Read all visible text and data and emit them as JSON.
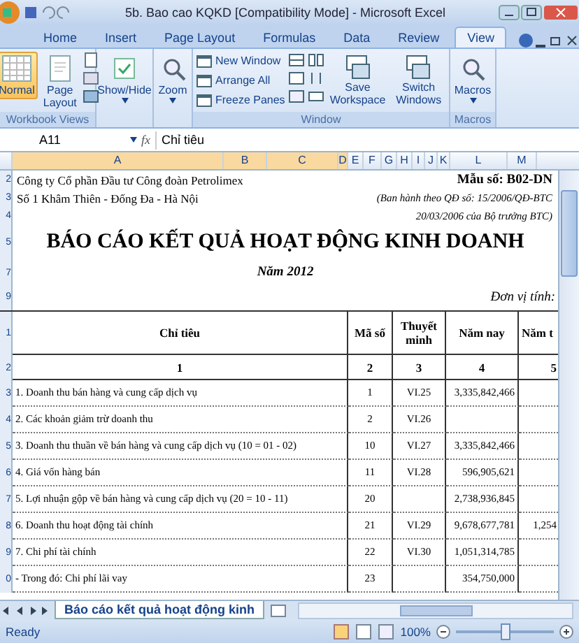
{
  "window": {
    "title": "5b. Bao cao KQKD  [Compatibility Mode] - Microsoft Excel"
  },
  "ribbon_tabs": [
    {
      "label": "Home",
      "selected": false
    },
    {
      "label": "Insert",
      "selected": false
    },
    {
      "label": "Page Layout",
      "selected": false
    },
    {
      "label": "Formulas",
      "selected": false
    },
    {
      "label": "Data",
      "selected": false
    },
    {
      "label": "Review",
      "selected": false
    },
    {
      "label": "View",
      "selected": true
    }
  ],
  "ribbon_groups": [
    {
      "kind": "views",
      "label": "Workbook Views",
      "buttons": [
        {
          "label": "Normal",
          "selected": true
        },
        {
          "label": "Page Layout",
          "selected": false
        }
      ]
    },
    {
      "kind": "single",
      "buttons": [
        {
          "label": "Show/Hide"
        }
      ]
    },
    {
      "kind": "single",
      "buttons": [
        {
          "label": "Zoom"
        }
      ]
    },
    {
      "kind": "window",
      "label": "Window",
      "small_buttons": [
        "New Window",
        "Arrange All",
        "Freeze Panes"
      ],
      "buttons": [
        {
          "label": "Save Workspace"
        },
        {
          "label": "Switch Windows"
        }
      ]
    },
    {
      "kind": "single",
      "label": "Macros",
      "buttons": [
        {
          "label": "Macros"
        }
      ]
    }
  ],
  "formula_bar": {
    "name_box": "A11",
    "function_label": "fx",
    "value": "Chỉ tiêu"
  },
  "column_headers": [
    "A",
    "B",
    "C",
    "D",
    "E",
    "F",
    "G",
    "H",
    "I",
    "J",
    "K",
    "L",
    "M"
  ],
  "sheet_lines": [
    {
      "kind": "pair",
      "row_number": "2",
      "left": "Công ty Cổ phần Đầu tư Công đoàn Petrolimex",
      "right": "Mẫu số:  B02-DN"
    },
    {
      "kind": "pair",
      "row_number": "3",
      "left": "Số 1 Khâm Thiên - Đống Đa - Hà Nội",
      "right": "(Ban hành theo QĐ số: 15/2006/QĐ-BTC"
    },
    {
      "kind": "note",
      "row_number": "4",
      "right": "20/03/2006 của Bộ trưởng BTC)"
    },
    {
      "kind": "title",
      "row_number": "5",
      "text": "BÁO CÁO KẾT QUẢ HOẠT ĐỘNG KINH DOANH"
    },
    {
      "kind": "subtitle",
      "row_number": "7",
      "text": "Năm 2012"
    },
    {
      "kind": "unit",
      "row_number": "9",
      "text": "Đơn vị tính:"
    }
  ],
  "table": {
    "header": {
      "row_number": "1",
      "cells": [
        "Chỉ tiêu",
        "Mã số",
        "Thuyết minh",
        "Năm nay",
        "Năm t"
      ]
    },
    "index_row": {
      "row_number": "2",
      "cells": [
        "1",
        "2",
        "3",
        "4",
        "5"
      ]
    },
    "rows": [
      {
        "row_number": "3",
        "cells": [
          "1. Doanh thu bán hàng và cung cấp dịch vụ",
          "1",
          "VI.25",
          "3,335,842,466",
          ""
        ]
      },
      {
        "row_number": "4",
        "cells": [
          "2. Các khoản giảm trừ doanh thu",
          "2",
          "VI.26",
          "",
          ""
        ]
      },
      {
        "row_number": "5",
        "cells": [
          "3. Doanh thu thuần về bán hàng và cung cấp dịch vụ (10 = 01 - 02)",
          "10",
          "VI.27",
          "3,335,842,466",
          ""
        ]
      },
      {
        "row_number": "6",
        "cells": [
          "4. Giá vốn hàng bán",
          "11",
          "VI.28",
          "596,905,621",
          ""
        ]
      },
      {
        "row_number": "7",
        "cells": [
          "5. Lợi nhuận gộp về bán hàng và cung cấp dịch vụ (20 = 10 - 11)",
          "20",
          "",
          "2,738,936,845",
          ""
        ]
      },
      {
        "row_number": "8",
        "cells": [
          "6. Doanh thu hoạt động tài chính",
          "21",
          "VI.29",
          "9,678,677,781",
          "1,254"
        ]
      },
      {
        "row_number": "9",
        "cells": [
          "7. Chi phí tài chính",
          "22",
          "VI.30",
          "1,051,314,785",
          ""
        ]
      },
      {
        "row_number": "0",
        "cells": [
          "- Trong đó: Chi phí lãi vay",
          "23",
          "",
          "354,750,000",
          ""
        ]
      }
    ]
  },
  "sheet_tabs": [
    {
      "label": "Báo cáo kết quả hoạt động kinh",
      "selected": true
    }
  ],
  "status_bar": {
    "status": "Ready",
    "zoom": "100%",
    "zoom_slider": {
      "level": 0.5
    }
  }
}
